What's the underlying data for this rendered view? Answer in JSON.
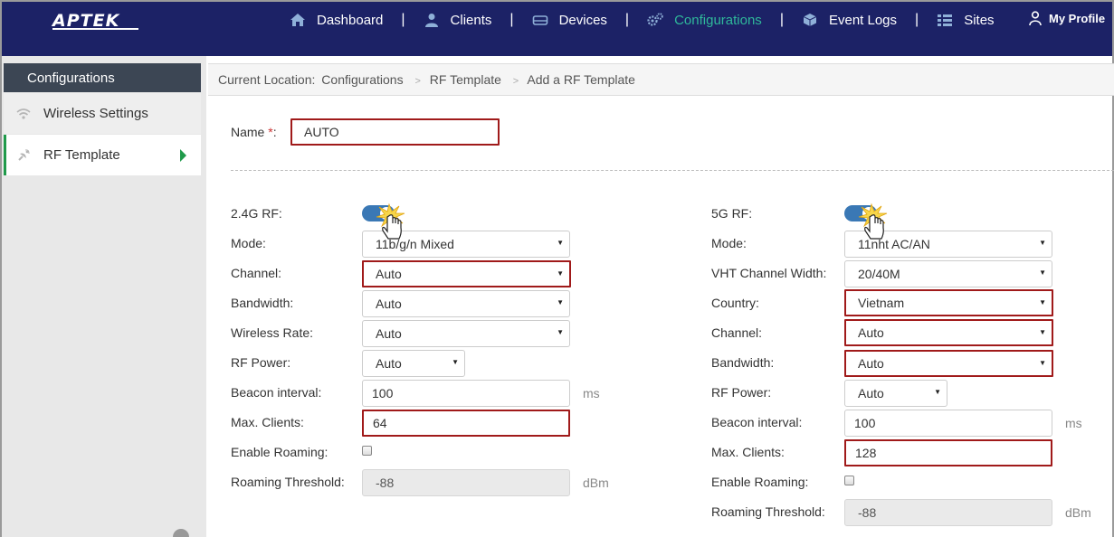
{
  "brand": {
    "logo": "APTEK"
  },
  "nav": {
    "items": [
      {
        "label": "Dashboard",
        "icon": "home-icon"
      },
      {
        "label": "Clients",
        "icon": "user-icon"
      },
      {
        "label": "Devices",
        "icon": "device-icon"
      },
      {
        "label": "Configurations",
        "icon": "gears-icon",
        "active": true
      },
      {
        "label": "Event Logs",
        "icon": "cube-icon"
      },
      {
        "label": "Sites",
        "icon": "sites-icon"
      }
    ],
    "separator": "|",
    "profile": "My Profile"
  },
  "sidebar": {
    "title": "Configurations",
    "items": [
      {
        "label": "Wireless Settings",
        "icon": "wifi-icon"
      },
      {
        "label": "RF Template",
        "icon": "satellite-icon",
        "active": true
      }
    ]
  },
  "breadcrumb": {
    "prefix": "Current Location:",
    "items": [
      "Configurations",
      "RF Template",
      "Add a RF Template"
    ],
    "separator": ">"
  },
  "form": {
    "name_label": "Name",
    "required_mark": "*",
    "colon": ":",
    "name_value": "AUTO"
  },
  "rf24": {
    "title": "2.4G RF:",
    "enabled": true,
    "mode_label": "Mode:",
    "mode_value": "11b/g/n Mixed",
    "channel_label": "Channel:",
    "channel_value": "Auto",
    "bandwidth_label": "Bandwidth:",
    "bandwidth_value": "Auto",
    "rate_label": "Wireless Rate:",
    "rate_value": "Auto",
    "power_label": "RF Power:",
    "power_value": "Auto",
    "beacon_label": "Beacon interval:",
    "beacon_value": "100",
    "beacon_unit": "ms",
    "max_clients_label": "Max. Clients:",
    "max_clients_value": "64",
    "roaming_label": "Enable Roaming:",
    "threshold_label": "Roaming Threshold:",
    "threshold_value": "-88",
    "threshold_unit": "dBm"
  },
  "rf5": {
    "title": "5G RF:",
    "enabled": true,
    "mode_label": "Mode:",
    "mode_value": "11nht AC/AN",
    "vht_label": "VHT Channel Width:",
    "vht_value": "20/40M",
    "country_label": "Country:",
    "country_value": "Vietnam",
    "channel_label": "Channel:",
    "channel_value": "Auto",
    "bandwidth_label": "Bandwidth:",
    "bandwidth_value": "Auto",
    "power_label": "RF Power:",
    "power_value": "Auto",
    "beacon_label": "Beacon interval:",
    "beacon_value": "100",
    "beacon_unit": "ms",
    "max_clients_label": "Max. Clients:",
    "max_clients_value": "128",
    "roaming_label": "Enable Roaming:",
    "threshold_label": "Roaming Threshold:",
    "threshold_value": "-88",
    "threshold_unit": "dBm"
  },
  "colors": {
    "nav_bg": "#1c2266",
    "accent": "#2fb89a",
    "error_border": "#a01a1a",
    "toggle_on": "#3a78b5"
  }
}
